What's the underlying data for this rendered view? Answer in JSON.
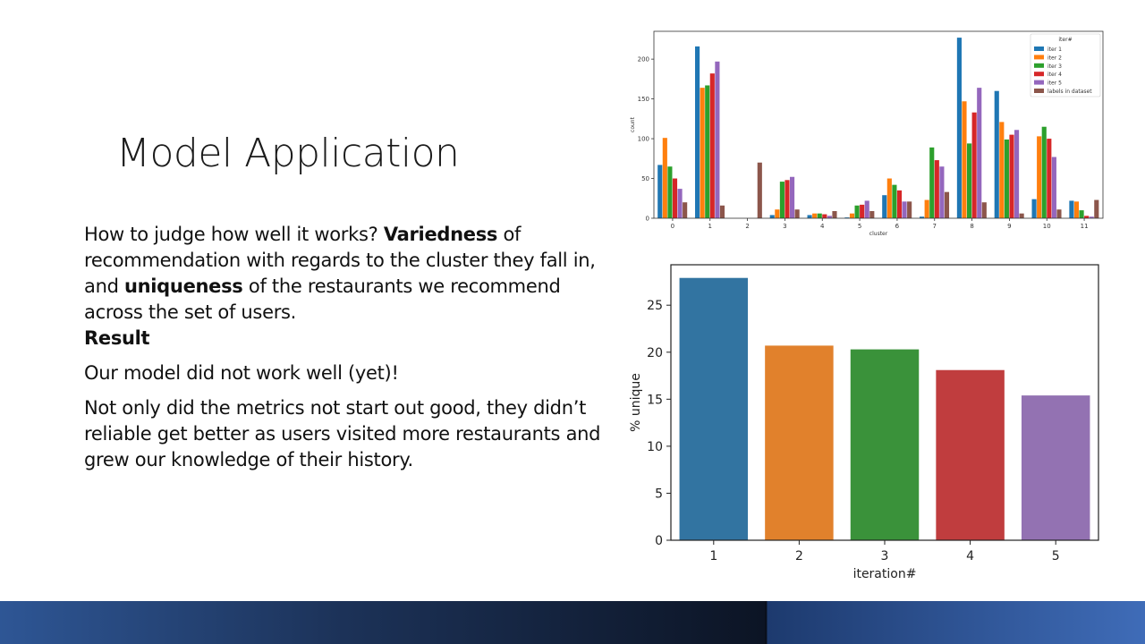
{
  "slide": {
    "title": "Model Application",
    "para1": {
      "t1": "How to judge how well it works? ",
      "b1": "Variedness",
      "t2": " of recommendation with regards to the cluster they fall in, and ",
      "b2": "uniqueness",
      "t3": " of the restaurants we recommend across the set of users."
    },
    "result_heading": "Result",
    "para2": "Our model did not work well (yet)!",
    "para3": "Not only did the metrics not start out good, they didn’t reliable get better as users visited more restaurants and grew our knowledge of their history."
  },
  "chart_data": [
    {
      "type": "bar",
      "xlabel": "cluster",
      "ylabel": "count",
      "legend_title": "iter#",
      "legend_position": "top-right",
      "categories": [
        "0",
        "1",
        "2",
        "3",
        "4",
        "5",
        "6",
        "7",
        "8",
        "9",
        "10",
        "11"
      ],
      "ylim": [
        0,
        235
      ],
      "yticks": [
        0,
        50,
        100,
        150,
        200
      ],
      "series": [
        {
          "name": "iter 1",
          "color": "#1f77b4",
          "values": [
            67,
            216,
            0,
            4,
            4,
            1,
            29,
            2,
            227,
            160,
            24,
            22
          ]
        },
        {
          "name": "iter 2",
          "color": "#ff7f0e",
          "values": [
            101,
            164,
            0,
            11,
            6,
            6,
            50,
            23,
            147,
            121,
            103,
            21
          ]
        },
        {
          "name": "iter 3",
          "color": "#2ca02c",
          "values": [
            65,
            167,
            0,
            46,
            6,
            16,
            42,
            89,
            94,
            99,
            115,
            10
          ]
        },
        {
          "name": "iter 4",
          "color": "#d62728",
          "values": [
            50,
            182,
            0,
            48,
            5,
            17,
            35,
            73,
            133,
            105,
            100,
            3
          ]
        },
        {
          "name": "iter 5",
          "color": "#9467bd",
          "values": [
            37,
            197,
            0,
            52,
            3,
            22,
            21,
            65,
            164,
            111,
            77,
            2
          ]
        },
        {
          "name": "labels in dataset",
          "color": "#8c564b",
          "values": [
            20,
            16,
            70,
            11,
            9,
            9,
            21,
            33,
            20,
            6,
            11,
            23
          ]
        }
      ]
    },
    {
      "type": "bar",
      "xlabel": "iteration#",
      "ylabel": "% unique",
      "categories": [
        "1",
        "2",
        "3",
        "4",
        "5"
      ],
      "values": [
        27.9,
        20.7,
        20.3,
        18.1,
        15.4
      ],
      "colors": [
        "#3274a1",
        "#e1812c",
        "#3a923a",
        "#c03d3e",
        "#9372b2"
      ],
      "ylim": [
        0,
        29.3
      ],
      "yticks": [
        0,
        5,
        10,
        15,
        20,
        25
      ]
    }
  ]
}
